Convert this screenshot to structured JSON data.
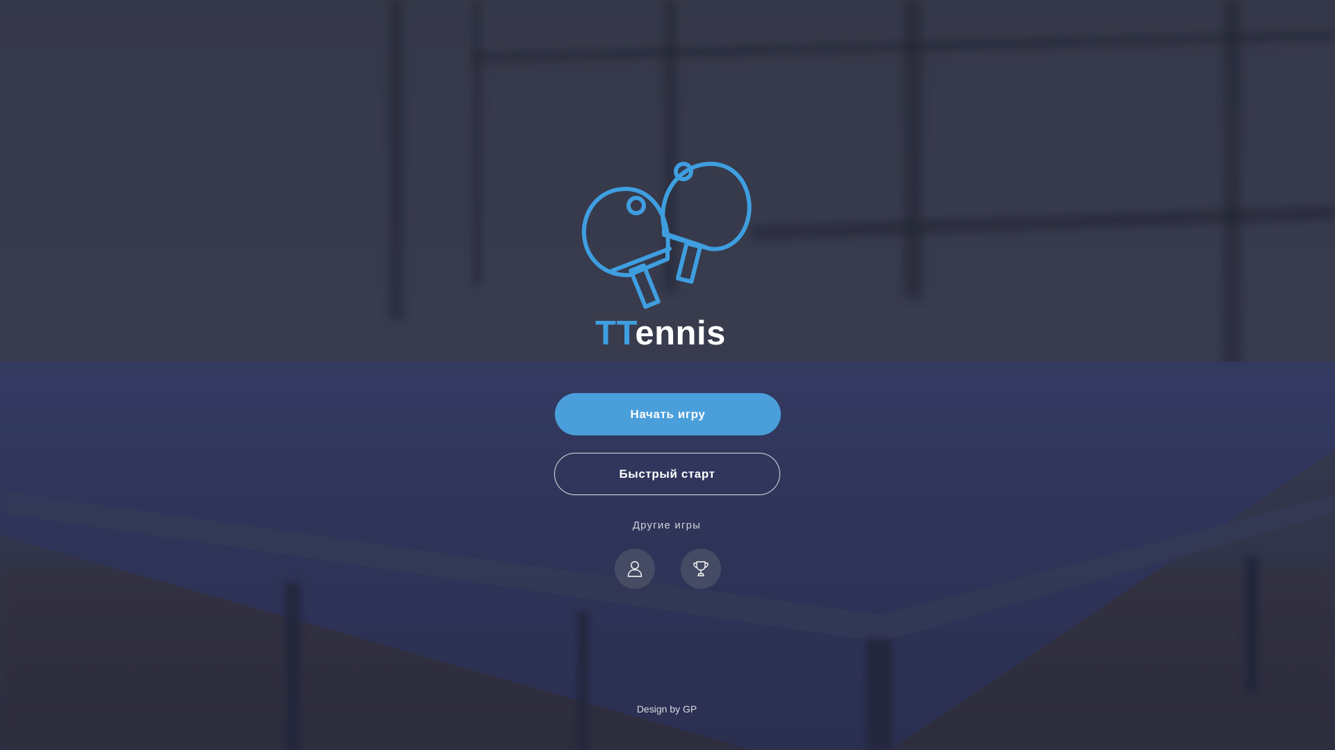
{
  "app": {
    "title_accent": "TT",
    "title_rest": "ennis",
    "logo_icon": "ping-pong-paddles-icon",
    "accent_color": "#3f9ee0"
  },
  "menu": {
    "start_game_label": "Начать игру",
    "quick_start_label": "Быстрый старт",
    "other_games_label": "Другие игры",
    "profile_icon": "user-icon",
    "leaderboard_icon": "trophy-icon",
    "primary_button_color": "#4a9fdb"
  },
  "footer": {
    "credit": "Design by GP"
  }
}
